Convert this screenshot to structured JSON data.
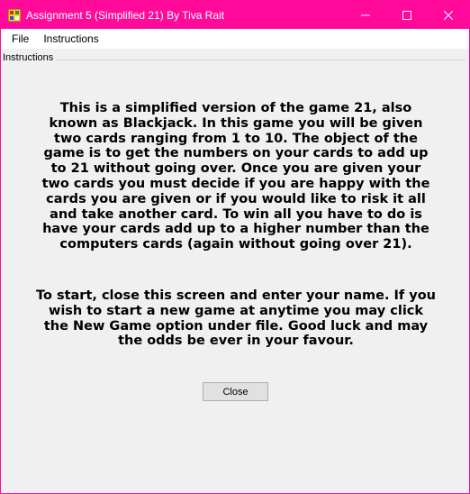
{
  "window": {
    "title": "Assignment 5 (Simplified 21) By Tiva Rait",
    "controls": {
      "minimize": "minimize-icon",
      "maximize": "maximize-icon",
      "close": "close-icon"
    },
    "title_bar_color": "#ff0a9a"
  },
  "menu": {
    "items": [
      {
        "label": "File"
      },
      {
        "label": "Instructions"
      }
    ]
  },
  "group": {
    "label": "Instructions"
  },
  "instructions": {
    "paragraph1": "This is a simplified version of the game 21, also\nknown as Blackjack. In this game you will be given\ntwo cards ranging from 1 to 10. The object of the\ngame is to get the numbers on your cards to add up\nto 21 without going over. Once you are given your\ntwo cards you must decide if you are happy with the\ncards you are given or if you would like to risk it all\nand take another card. To win all you have to do is\nhave your cards add up to a higher number than the\ncomputers cards (again without going over 21).",
    "paragraph2": "To start, close this screen and enter your name. If you\nwish to start a new game at anytime you may click\nthe New Game option under file. Good luck and may\nthe odds be ever in your favour."
  },
  "buttons": {
    "close_label": "Close"
  }
}
